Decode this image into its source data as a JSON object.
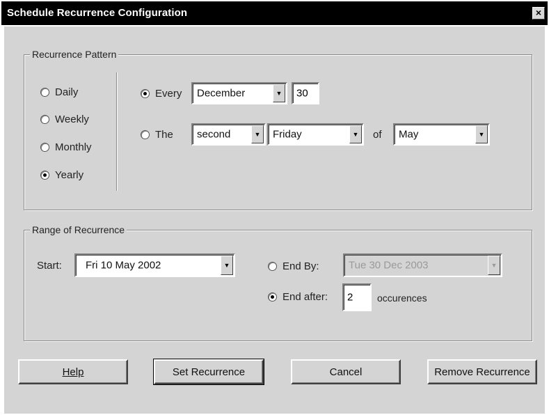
{
  "window": {
    "title": "Schedule Recurrence Configuration",
    "close_label": "×"
  },
  "pattern": {
    "label": "Recurrence Pattern",
    "frequency": [
      {
        "label": "Daily",
        "checked": false
      },
      {
        "label": "Weekly",
        "checked": false
      },
      {
        "label": "Monthly",
        "checked": false
      },
      {
        "label": "Yearly",
        "checked": true
      }
    ],
    "every": {
      "label": "Every",
      "checked": true,
      "month": "December",
      "day": "30"
    },
    "the": {
      "label": "The",
      "checked": false,
      "ordinal": "second",
      "weekday": "Friday",
      "of_label": "of",
      "month": "May"
    }
  },
  "range": {
    "label": "Range of Recurrence",
    "start_label": "Start:",
    "start_value": "Fri  10 May 2002",
    "end_by": {
      "label": "End By:",
      "checked": false,
      "value": "Tue 30 Dec 2003"
    },
    "end_after": {
      "label": "End after:",
      "checked": true,
      "value": "2",
      "suffix": "occurences"
    }
  },
  "buttons": {
    "help": "Help",
    "set": "Set Recurrence",
    "cancel": "Cancel",
    "remove": "Remove Recurrence"
  }
}
